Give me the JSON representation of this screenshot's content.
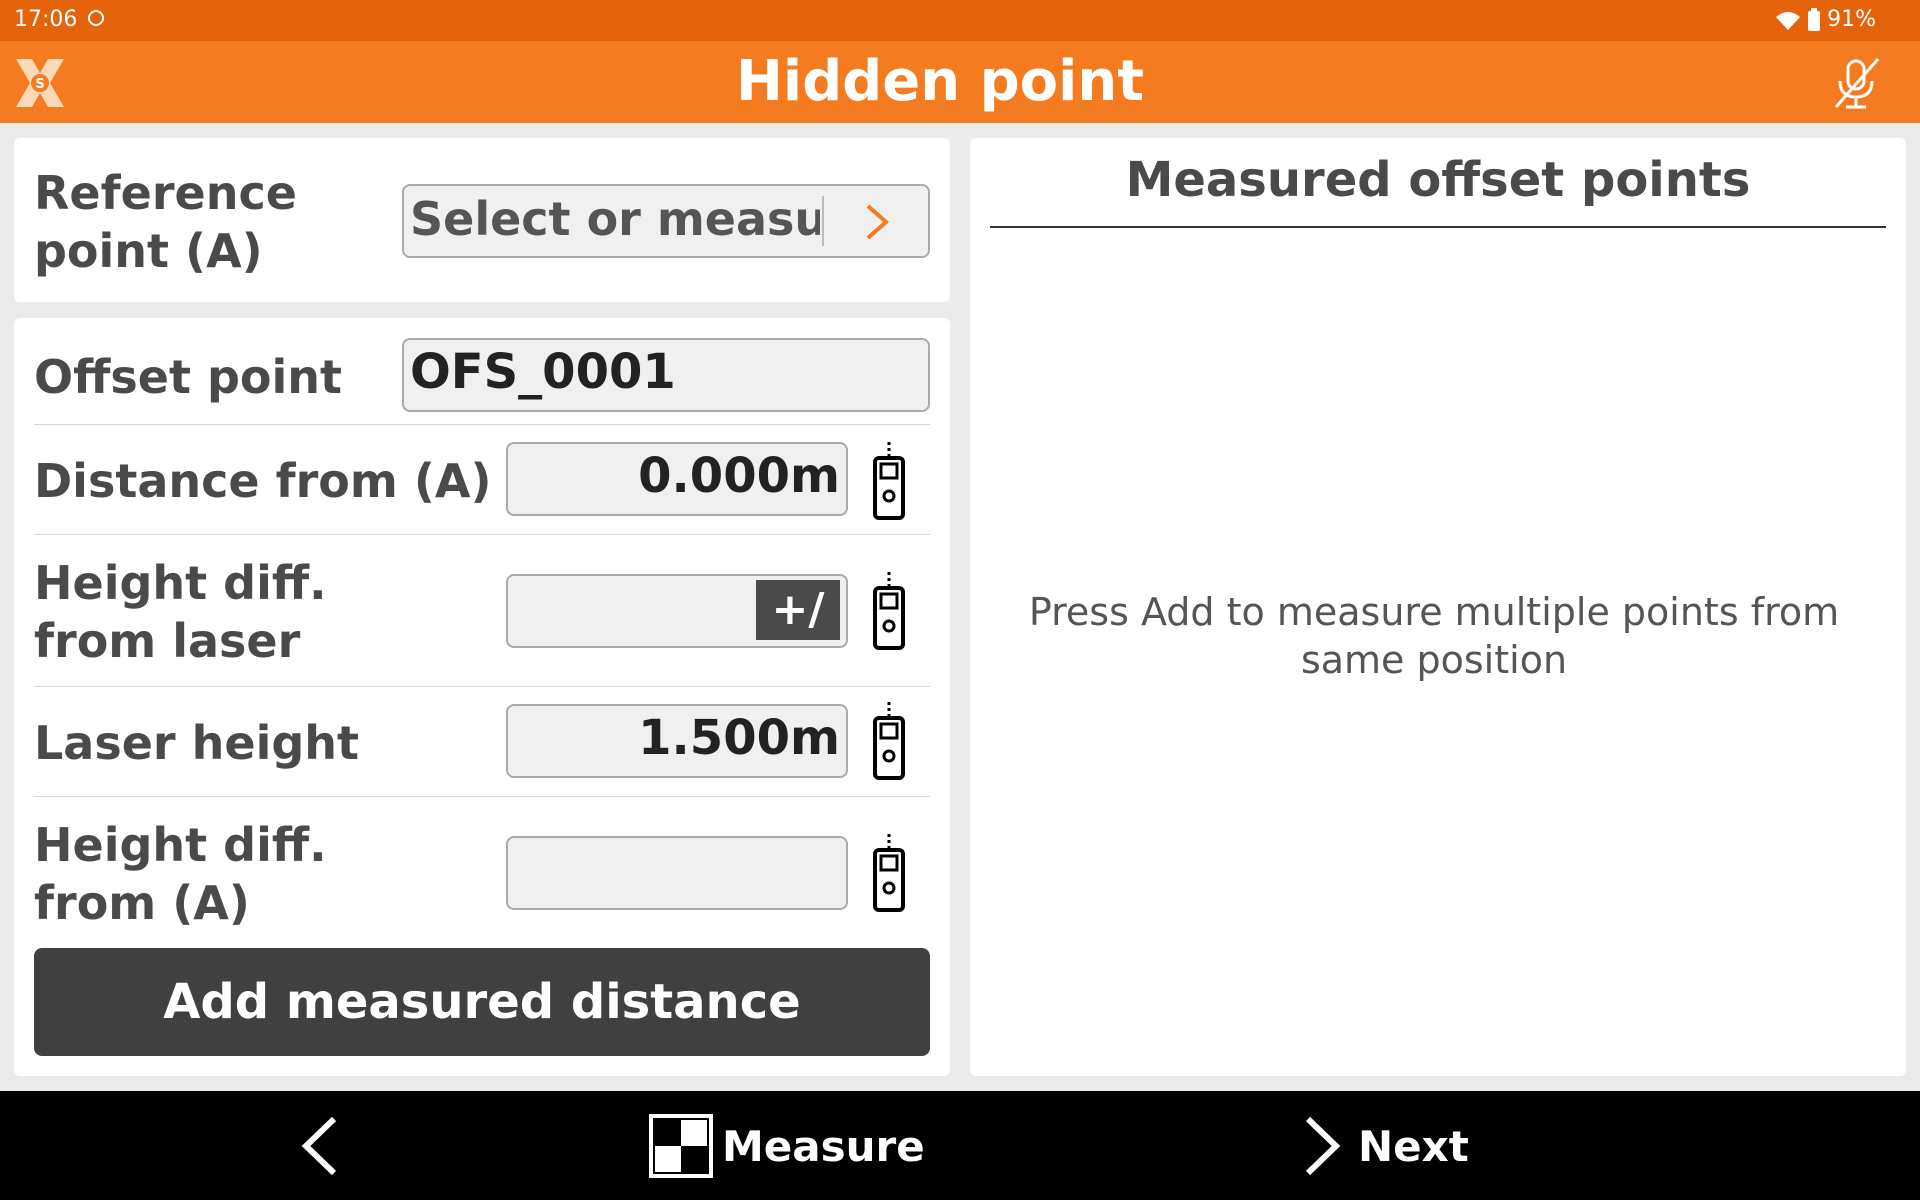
{
  "status_bar": {
    "time": "17:06",
    "battery": "91%"
  },
  "header": {
    "title": "Hidden point"
  },
  "reference": {
    "label": "Reference point (A)",
    "placeholder": "Select or measure"
  },
  "offset_point": {
    "label": "Offset point",
    "value": "OFS_0001"
  },
  "distance": {
    "label": "Distance from (A)",
    "value": "0.000m"
  },
  "height_diff_laser": {
    "label": "Height diff. from laser",
    "value": "",
    "toggle_label": "+/−"
  },
  "laser_height": {
    "label": "Laser height",
    "value": "1.500m"
  },
  "height_diff_a": {
    "label": "Height diff. from (A)",
    "value": ""
  },
  "add_button": {
    "label": "Add measured distance"
  },
  "right_panel": {
    "title": "Measured offset points",
    "empty_message": "Press Add to measure multiple points from same position"
  },
  "bottom_nav": {
    "measure_label": "Measure",
    "next_label": "Next"
  }
}
